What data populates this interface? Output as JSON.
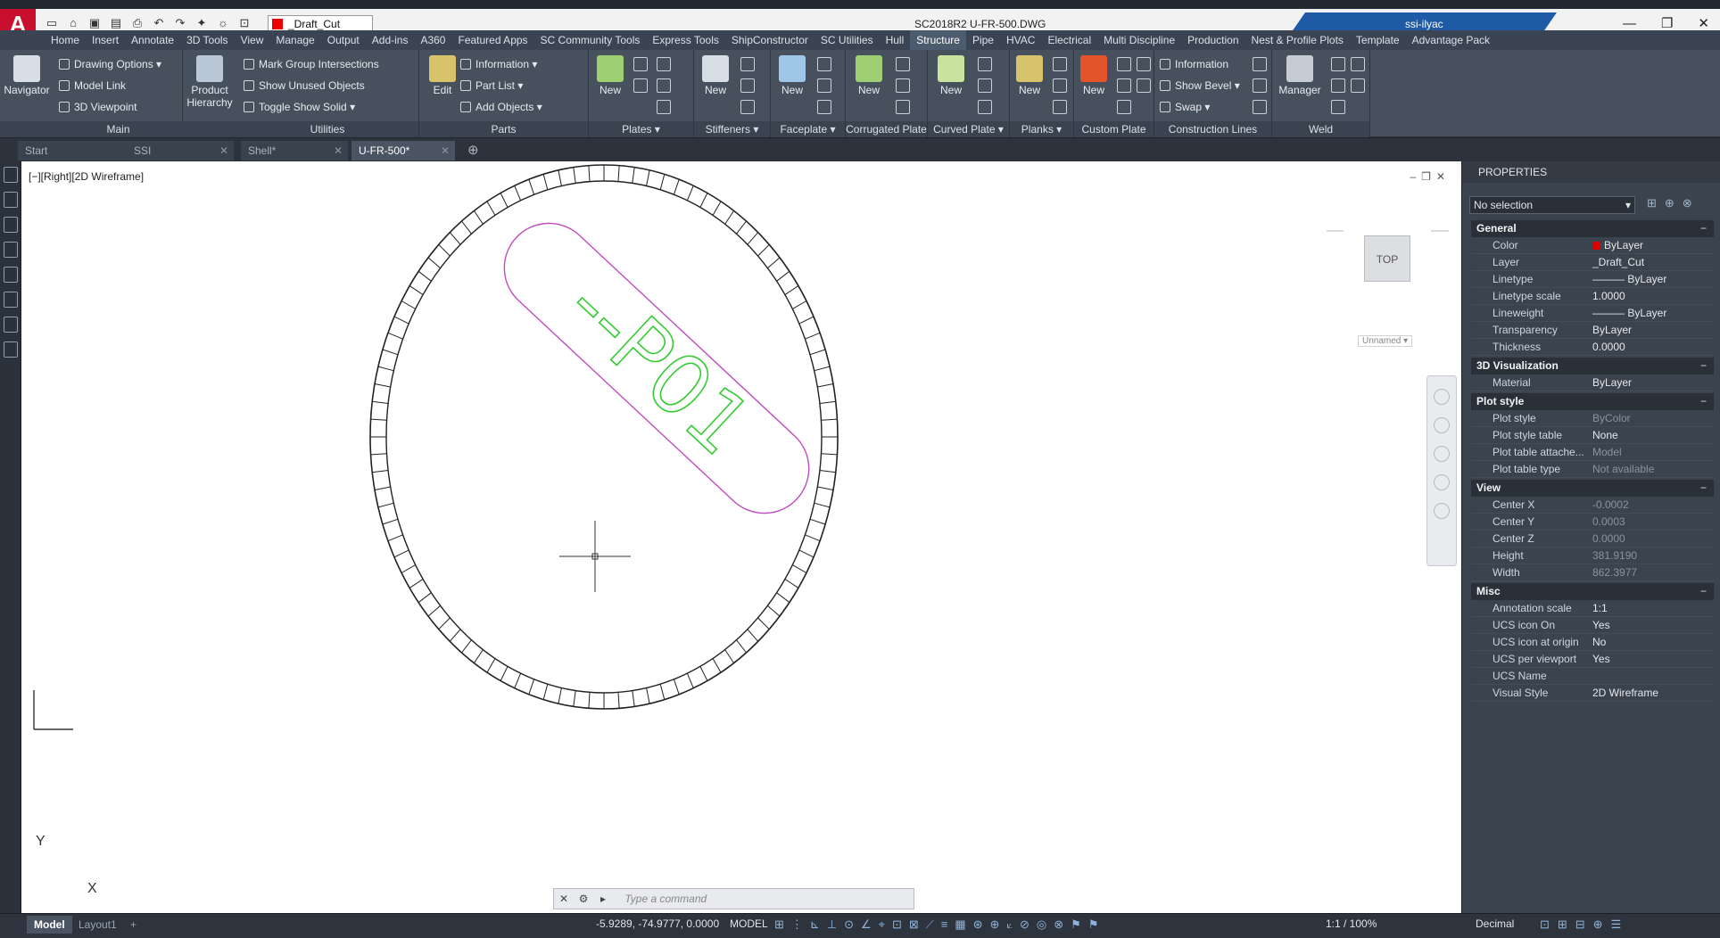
{
  "titlebar": {
    "app_logo": "A",
    "layer_name": "_Draft_Cut",
    "doc_title": "SC2018R2   U-FR-500.DWG",
    "user": "ssi-ilyac",
    "win_min": "—",
    "win_max": "❐",
    "win_close": "✕"
  },
  "ribbon_tabs": [
    "Home",
    "Insert",
    "Annotate",
    "3D Tools",
    "View",
    "Manage",
    "Output",
    "Add-ins",
    "A360",
    "Featured Apps",
    "SC Community Tools",
    "Express Tools",
    "ShipConstructor",
    "SC Utilities",
    "Hull",
    "Structure",
    "Pipe",
    "HVAC",
    "Electrical",
    "Multi Discipline",
    "Production",
    "Nest & Profile Plots",
    "Template",
    "Advantage Pack"
  ],
  "active_tab": "Structure",
  "panels": {
    "main": {
      "title": "Main",
      "navigator": "Navigator",
      "drawing_options": "Drawing Options",
      "model_link": "Model Link",
      "viewpoint": "3D Viewpoint",
      "product": "Product",
      "hierarchy": "Hierarchy"
    },
    "utilities": {
      "title": "Utilities",
      "mark_group": "Mark Group Intersections",
      "show_unused": "Show Unused Objects",
      "toggle_solid": "Toggle Show Solid"
    },
    "parts": {
      "title": "Parts",
      "edit": "Edit",
      "information": "Information",
      "part_list": "Part List",
      "add_objects": "Add Objects"
    },
    "plates": {
      "title": "Plates",
      "new": "New"
    },
    "stiffeners": {
      "title": "Stiffeners",
      "new": "New"
    },
    "faceplate": {
      "title": "Faceplate",
      "new": "New"
    },
    "corrugated": {
      "title": "Corrugated Plate",
      "new": "New"
    },
    "curved": {
      "title": "Curved Plate",
      "new": "New"
    },
    "planks": {
      "title": "Planks",
      "new": "New"
    },
    "custom_plate": {
      "title": "Custom Plate",
      "new": "New"
    },
    "construction": {
      "title": "Construction Lines",
      "information": "Information",
      "show_bevel": "Show Bevel",
      "swap": "Swap"
    },
    "weld": {
      "title": "Weld",
      "manager": "Manager"
    }
  },
  "doc_tabs": [
    "Start",
    "SSI",
    "Shell*",
    "U-FR-500*"
  ],
  "active_doc": "U-FR-500*",
  "viewport": {
    "label": "[−][Right][2D Wireframe]",
    "viewcube": "TOP",
    "ucs_name": "Unnamed",
    "drawing_text": "--P01",
    "axis_y": "Y",
    "axis_x": "X",
    "command_placeholder": "Type a command"
  },
  "properties": {
    "title": "PROPERTIES",
    "selection": "No selection",
    "sections": [
      {
        "name": "General",
        "rows": [
          {
            "k": "Color",
            "v": "ByLayer",
            "swatch": "#e00000"
          },
          {
            "k": "Layer",
            "v": "_Draft_Cut"
          },
          {
            "k": "Linetype",
            "v": "——— ByLayer"
          },
          {
            "k": "Linetype scale",
            "v": "1.0000"
          },
          {
            "k": "Lineweight",
            "v": "——— ByLayer"
          },
          {
            "k": "Transparency",
            "v": "ByLayer"
          },
          {
            "k": "Thickness",
            "v": "0.0000"
          }
        ]
      },
      {
        "name": "3D Visualization",
        "rows": [
          {
            "k": "Material",
            "v": "ByLayer"
          }
        ]
      },
      {
        "name": "Plot style",
        "rows": [
          {
            "k": "Plot style",
            "v": "ByColor",
            "dim": true
          },
          {
            "k": "Plot style table",
            "v": "None"
          },
          {
            "k": "Plot table attache...",
            "v": "Model",
            "dim": true
          },
          {
            "k": "Plot table type",
            "v": "Not available",
            "dim": true
          }
        ]
      },
      {
        "name": "View",
        "rows": [
          {
            "k": "Center X",
            "v": "-0.0002",
            "dim": true
          },
          {
            "k": "Center Y",
            "v": "0.0003",
            "dim": true
          },
          {
            "k": "Center Z",
            "v": "0.0000",
            "dim": true
          },
          {
            "k": "Height",
            "v": "381.9190",
            "dim": true
          },
          {
            "k": "Width",
            "v": "862.3977",
            "dim": true
          }
        ]
      },
      {
        "name": "Misc",
        "rows": [
          {
            "k": "Annotation scale",
            "v": "1:1"
          },
          {
            "k": "UCS icon On",
            "v": "Yes"
          },
          {
            "k": "UCS icon at origin",
            "v": "No"
          },
          {
            "k": "UCS per viewport",
            "v": "Yes"
          },
          {
            "k": "UCS Name",
            "v": ""
          },
          {
            "k": "Visual Style",
            "v": "2D Wireframe"
          }
        ]
      }
    ]
  },
  "statusbar": {
    "model_tab": "Model",
    "layout_tab": "Layout1",
    "add_tab": "+",
    "coords": "-5.9289, -74.9777, 0.0000",
    "space": "MODEL",
    "annotation_scale": "1:1 / 100%",
    "units": "Decimal"
  },
  "colors": {
    "plate_outline": "#c04cc0",
    "text_green": "#33cc33",
    "accent": "#1e5aa6"
  }
}
